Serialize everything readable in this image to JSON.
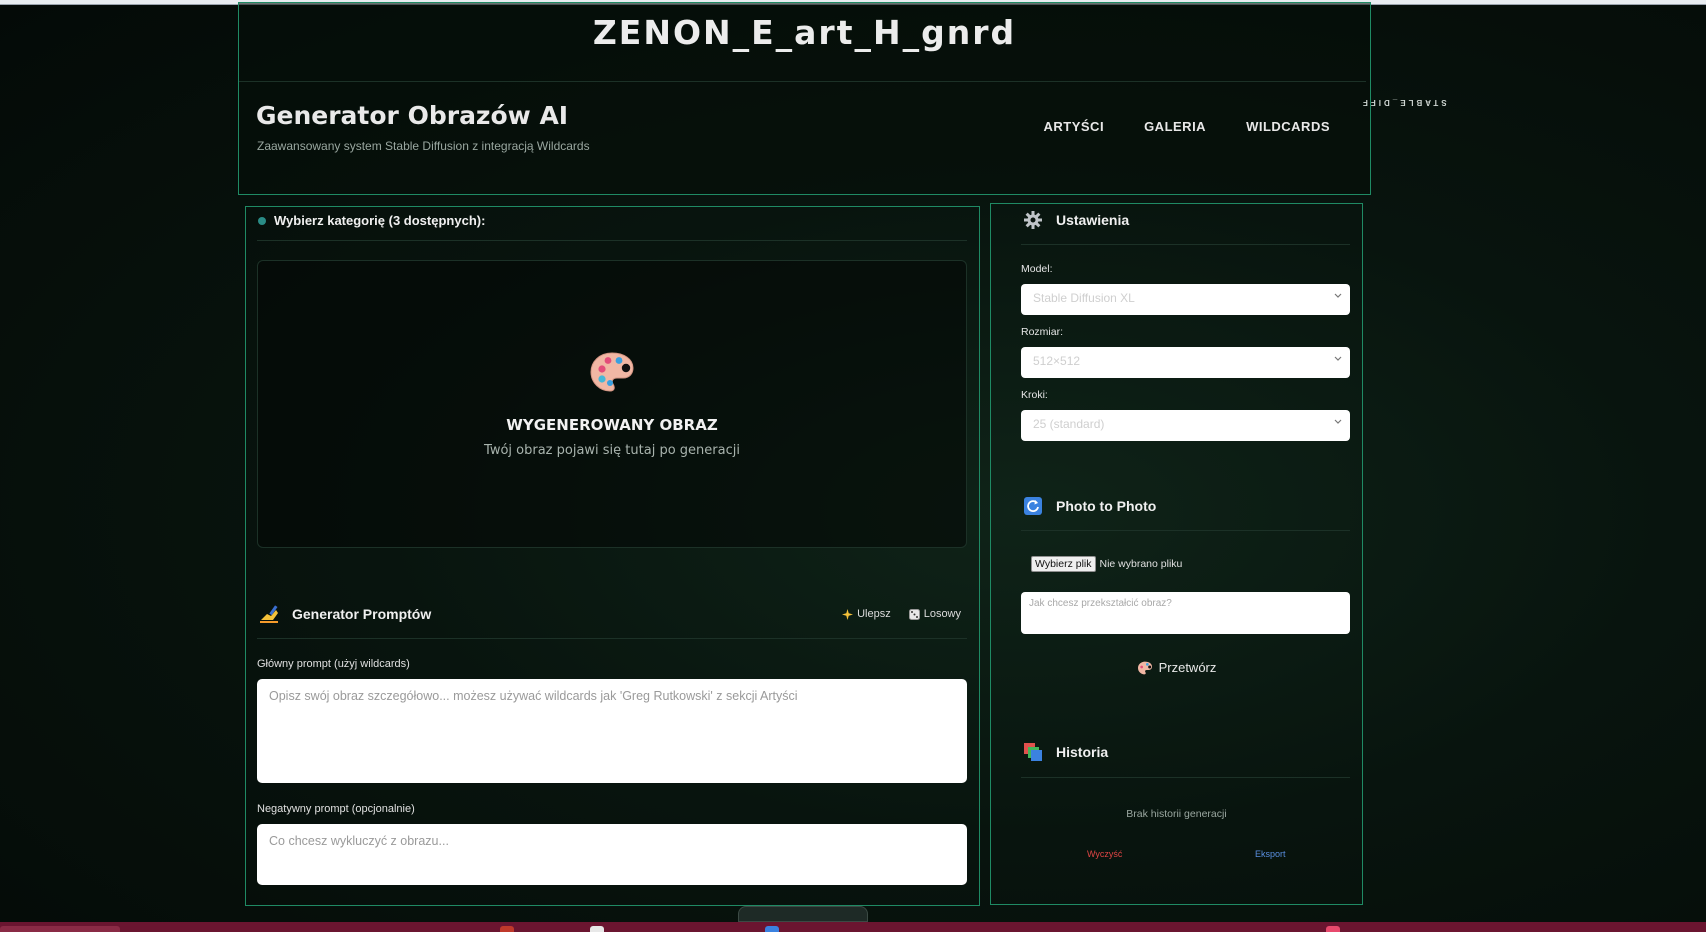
{
  "header": {
    "brand": "ZENON_E_art_H_gnrd",
    "app_title": "Generator Obrazów AI",
    "app_subtitle": "Zaawansowany system Stable Diffusion z integracją Wildcards",
    "nav": [
      "ARTYŚCI",
      "GALERIA",
      "WILDCARDS"
    ],
    "marquee": "STABLE_DIFF"
  },
  "main": {
    "category_label": "Wybierz kategorię (3 dostępnych):",
    "preview": {
      "icon": "palette-icon",
      "title": "WYGENEROWANY OBRAZ",
      "subtitle": "Twój obraz pojawi się tutaj po generacji"
    },
    "prompt_generator": {
      "icon": "writing-hand-icon",
      "title": "Generator Promptów",
      "enhance_label": "Ulepsz",
      "random_label": "Losowy",
      "main_label": "Główny prompt (użyj wildcards)",
      "main_placeholder": "Opisz swój obraz szczegółowo... możesz używać wildcards jak 'Greg Rutkowski' z sekcji Artyści",
      "negative_label": "Negatywny prompt (opcjonalnie)",
      "negative_placeholder": "Co chcesz wykluczyć z obrazu..."
    }
  },
  "settings": {
    "icon": "gear-icon",
    "title": "Ustawienia",
    "model_label": "Model:",
    "model_value": "Stable Diffusion XL",
    "size_label": "Rozmiar:",
    "size_value": "512×512",
    "steps_label": "Kroki:",
    "steps_value": "25 (standard)"
  },
  "photo_to_photo": {
    "icon": "refresh-icon",
    "title": "Photo to Photo",
    "file_button": "Wybierz plik",
    "file_status": "Nie wybrano pliku",
    "transform_placeholder": "Jak chcesz przekształcić obraz?",
    "transform_button": "Przetwórz"
  },
  "history": {
    "icon": "history-icon",
    "title": "Historia",
    "empty_text": "Brak historii generacji",
    "clear_label": "Wyczyść",
    "export_label": "Eksport"
  },
  "colors": {
    "accent_border": "#1f8a64",
    "background": "#08140e",
    "danger": "#e04545",
    "link": "#5a8fe0"
  }
}
